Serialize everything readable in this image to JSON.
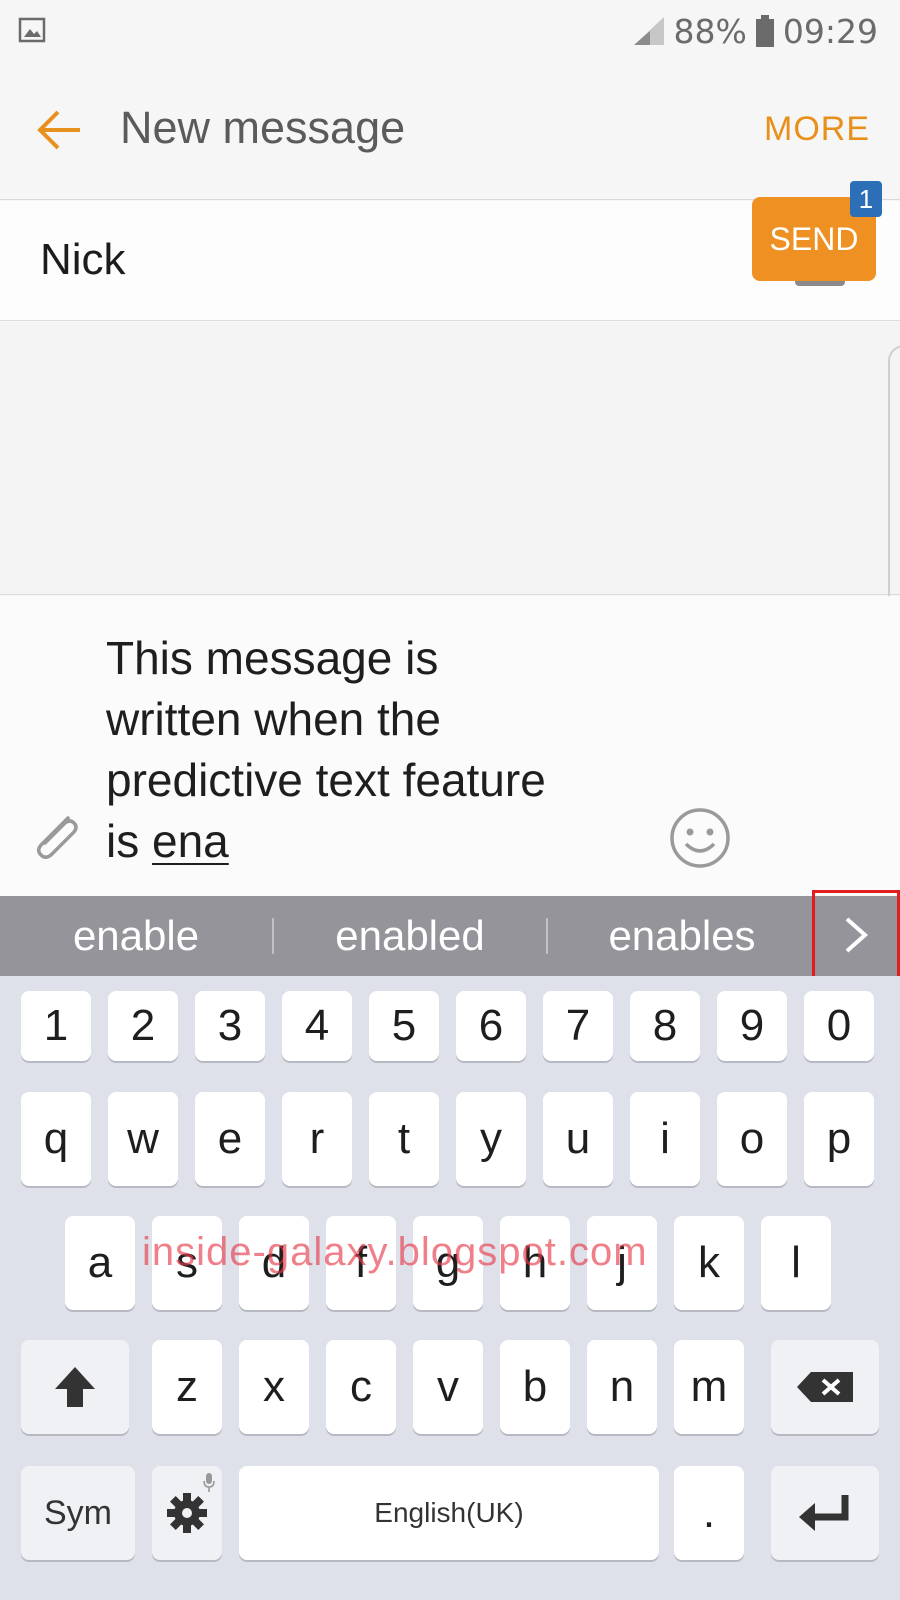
{
  "status_bar": {
    "battery": "88%",
    "time": "09:29"
  },
  "header": {
    "title": "New message",
    "more_label": "MORE"
  },
  "recipient": {
    "name": "Nick"
  },
  "compose": {
    "text_line_1": "This message is",
    "text_line_2": "written when the",
    "text_line_3": "predictive text feature",
    "text_line_4_prefix": "is ",
    "composing_word": "ena",
    "send_label": "SEND",
    "sim_badge": "1"
  },
  "suggestions": [
    "enable",
    "enabled",
    "enables"
  ],
  "keyboard": {
    "row_numbers": [
      "1",
      "2",
      "3",
      "4",
      "5",
      "6",
      "7",
      "8",
      "9",
      "0"
    ],
    "row_1": [
      "q",
      "w",
      "e",
      "r",
      "t",
      "y",
      "u",
      "i",
      "o",
      "p"
    ],
    "row_2": [
      "a",
      "s",
      "d",
      "f",
      "g",
      "h",
      "j",
      "k",
      "l"
    ],
    "row_3": [
      "z",
      "x",
      "c",
      "v",
      "b",
      "n",
      "m"
    ],
    "sym_label": "Sym",
    "space_label": "English(UK)",
    "period_label": "."
  },
  "watermark": "inside-galaxy.blogspot.com",
  "colors": {
    "accent": "#e8901c",
    "send": "#ef9122",
    "suggestion_bar": "#95949a",
    "highlight": "#e01e1e"
  }
}
